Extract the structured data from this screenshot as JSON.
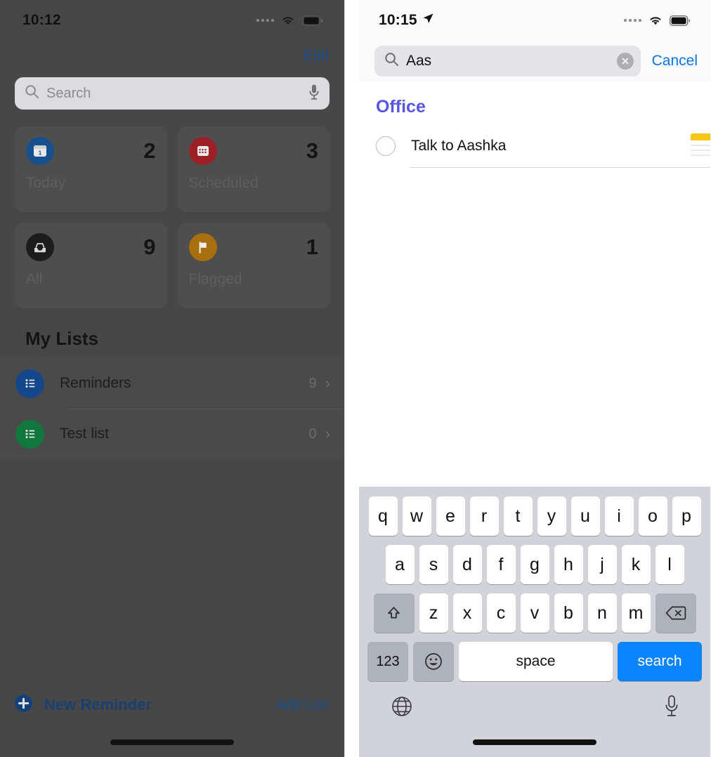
{
  "left_panel": {
    "status_bar": {
      "time": "10:12",
      "signal_icon": "signal-dots-icon",
      "wifi_icon": "wifi-icon",
      "battery_icon": "battery-icon"
    },
    "edit_label": "Edit",
    "search": {
      "placeholder": "Search",
      "search_icon": "magnifier-icon",
      "mic_icon": "microphone-icon"
    },
    "smart_lists": [
      {
        "label": "Today",
        "count": "2",
        "icon": "calendar-day-icon",
        "color": "#17508f"
      },
      {
        "label": "Scheduled",
        "count": "3",
        "icon": "calendar-icon",
        "color": "#9c2026"
      },
      {
        "label": "All",
        "count": "9",
        "icon": "inbox-tray-icon",
        "color": "#1c1c1c"
      },
      {
        "label": "Flagged",
        "count": "1",
        "icon": "flag-icon",
        "color": "#a8700c"
      }
    ],
    "my_lists_title": "My Lists",
    "lists": [
      {
        "name": "Reminders",
        "count": "9",
        "icon": "list-bullet-icon",
        "color": "#14478c",
        "chevron": "chevron-right-icon"
      },
      {
        "name": "Test list",
        "count": "0",
        "icon": "list-bullet-icon",
        "color": "#11773c",
        "chevron": "chevron-right-icon"
      }
    ],
    "toolbar": {
      "new_reminder_label": "New Reminder",
      "new_reminder_icon": "plus-circle-icon",
      "add_list_label": "Add List"
    }
  },
  "right_panel": {
    "status_bar": {
      "time": "10:15",
      "location_icon": "location-arrow-icon",
      "signal_icon": "signal-dots-icon",
      "wifi_icon": "wifi-icon",
      "battery_icon": "battery-icon"
    },
    "search": {
      "value": "Aas",
      "search_icon": "magnifier-icon",
      "clear_icon": "clear-circle-icon",
      "cancel_label": "Cancel"
    },
    "results": {
      "section_header": "Office",
      "section_color": "#5856e0",
      "items": [
        {
          "title": "Talk to Aashka",
          "checkbox_icon": "circle-checkbox-icon",
          "attachment_icon": "notes-app-icon"
        }
      ]
    },
    "keyboard": {
      "row1": [
        "q",
        "w",
        "e",
        "r",
        "t",
        "y",
        "u",
        "i",
        "o",
        "p"
      ],
      "row2": [
        "a",
        "s",
        "d",
        "f",
        "g",
        "h",
        "j",
        "k",
        "l"
      ],
      "row3_letters": [
        "z",
        "x",
        "c",
        "v",
        "b",
        "n",
        "m"
      ],
      "shift_icon": "shift-arrow-icon",
      "delete_icon": "backspace-icon",
      "numbers_label": "123",
      "emoji_icon": "smiley-icon",
      "space_label": "space",
      "search_label": "search",
      "globe_icon": "globe-icon",
      "mic_icon": "microphone-icon"
    }
  }
}
